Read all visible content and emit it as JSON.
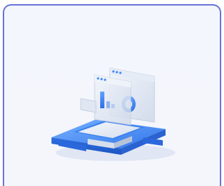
{
  "card": {
    "illustration": "dashboard-platform-illustration",
    "colors": {
      "border": "#6571d6",
      "background": "#f3f6fd",
      "accent_blue": "#3f86f5",
      "window_glass": "#dfe6f2"
    }
  }
}
